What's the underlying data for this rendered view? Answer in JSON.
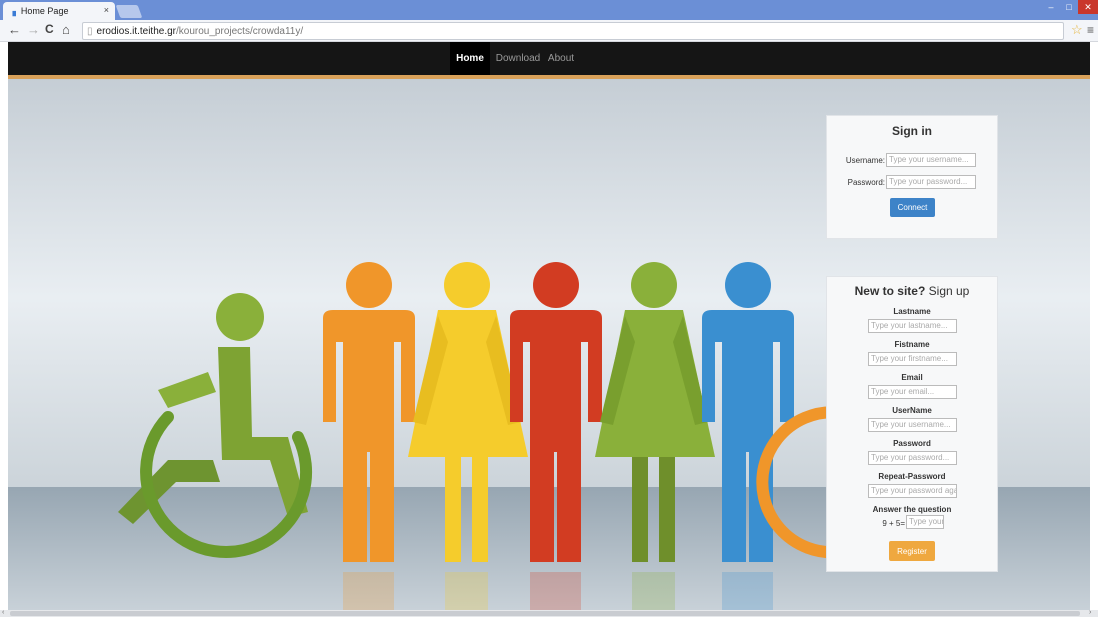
{
  "browser": {
    "tab_title": "Home Page",
    "tab_close": "×",
    "url_host": "erodios.it.teithe.gr",
    "url_path": "/kourou_projects/crowda11y/",
    "window_controls": {
      "minimize": "–",
      "maximize": "□",
      "close": "✕"
    },
    "back_icon": "←",
    "forward_icon": "→",
    "reload_icon": "C",
    "home_icon": "⌂",
    "star_icon": "☆",
    "menu_icon": "≡"
  },
  "nav": {
    "items": [
      "Home",
      "Download",
      "About"
    ],
    "active": "Home"
  },
  "signin": {
    "title": "Sign in",
    "username_label": "Username:",
    "username_placeholder": "Type your username...",
    "password_label": "Password:",
    "password_placeholder": "Type your password...",
    "connect_label": "Connect"
  },
  "signup": {
    "title_bold": "New to site?",
    "title_rest": " Sign up",
    "fields": [
      {
        "label": "Lastname",
        "placeholder": "Type your lastname..."
      },
      {
        "label": "Fistname",
        "placeholder": "Type your firstname..."
      },
      {
        "label": "Email",
        "placeholder": "Type your email..."
      },
      {
        "label": "UserName",
        "placeholder": "Type your username..."
      },
      {
        "label": "Password",
        "placeholder": "Type your password..."
      },
      {
        "label": "Repeat-Password",
        "placeholder": "Type your password again..."
      }
    ],
    "question_label": "Answer the question",
    "question_text": "9 + 5=",
    "answer_placeholder": "Type your",
    "register_label": "Register"
  },
  "colors": {
    "nav_bg": "#151515",
    "nav_accent": "#d8a15a",
    "connect": "#3d83c8",
    "register": "#efa83f",
    "figure_green": "#8ab03a",
    "figure_orange": "#f0962a",
    "figure_yellow": "#f5cc2c",
    "figure_red": "#d23c22",
    "figure_blue": "#3a8fd0"
  }
}
